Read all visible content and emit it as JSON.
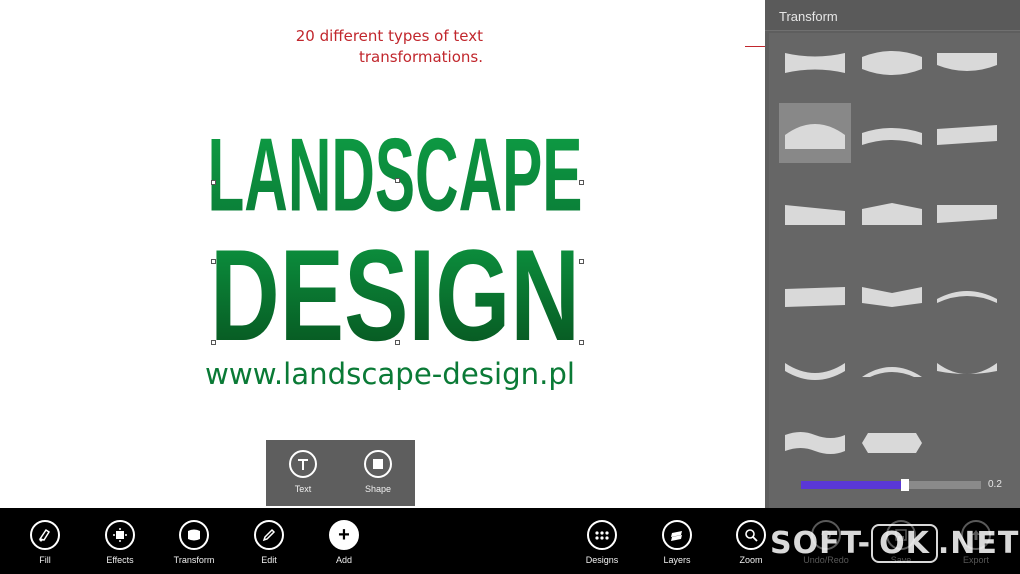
{
  "canvas": {
    "logo": {
      "line1": "LANDSCAPE",
      "line2": "DESIGN",
      "url": "www.landscape-design.pl",
      "color_top": "#0b9a43",
      "color_bottom": "#075b22"
    },
    "callout": {
      "line1": "20 different types of text",
      "line2": "transformations.",
      "color": "#c1272d"
    }
  },
  "transform_panel": {
    "title": "Transform",
    "slider_value": "0.2",
    "slider_fraction": 0.58,
    "accent": "#5a37d6"
  },
  "add_popup": {
    "items": [
      {
        "label": "Text",
        "icon": "text-icon"
      },
      {
        "label": "Shape",
        "icon": "shape-icon"
      }
    ]
  },
  "appbar": {
    "left": [
      {
        "label": "Fill",
        "icon": "fill-icon"
      },
      {
        "label": "Effects",
        "icon": "effects-icon"
      },
      {
        "label": "Transform",
        "icon": "transform-icon"
      },
      {
        "label": "Edit",
        "icon": "edit-icon"
      },
      {
        "label": "Add",
        "icon": "add-icon"
      }
    ],
    "right": [
      {
        "label": "Designs",
        "icon": "designs-icon"
      },
      {
        "label": "Layers",
        "icon": "layers-icon"
      },
      {
        "label": "Zoom",
        "icon": "zoom-icon"
      },
      {
        "label": "Undo/Redo",
        "icon": "undo-redo-icon"
      },
      {
        "label": "Save",
        "icon": "save-icon"
      },
      {
        "label": "Export",
        "icon": "export-icon"
      }
    ]
  },
  "watermark": {
    "part1": "SOFT-",
    "part2": "OK",
    "part3": ".NET"
  }
}
